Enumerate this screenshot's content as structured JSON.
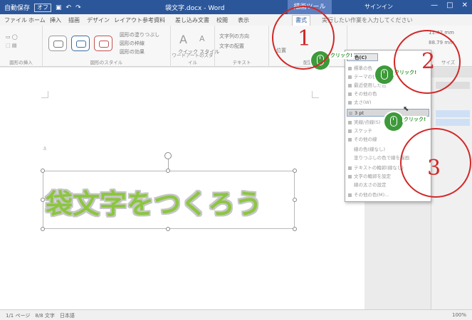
{
  "titlebar": {
    "autosave_label": "自動保存",
    "autosave_state": "オフ",
    "doc_title": "袋文字.docx - Word",
    "context_tab": "描画ツール",
    "user": "サインイン",
    "min_glyph": "—",
    "max_glyph": "□",
    "close_glyph": "✕"
  },
  "ribbon": {
    "tabs": [
      "ファイル",
      "ホーム",
      "挿入",
      "描画",
      "デザイン",
      "レイアウト",
      "参考資料",
      "差し込み文書",
      "校閲",
      "表示"
    ],
    "active_tab": "書式",
    "search_placeholder": "実行したい作業を入力してください",
    "groups": {
      "insert_shapes": "図形の挿入",
      "shape_styles": "図形のスタイル",
      "wordart_styles": "ワードアートのスタイル",
      "text": "テキスト",
      "arrange": "配置",
      "size": "サイズ"
    },
    "fill_label": "図形の塗りつぶし",
    "outline_label": "図形の枠線",
    "effects_label": "図形の効果",
    "quick_styles": "クイック スタイル",
    "text_direction": "文字列の方向",
    "text_align": "文字の配置",
    "position": "位置",
    "height": "11.42 mm",
    "width": "88.79 mm"
  },
  "menu": {
    "header": "色(C)",
    "items": [
      "標準の色",
      "テーマの色",
      "最近使用した色",
      "その他の色",
      "太さ(W)",
      "実線/点線(S)",
      "スケッチ",
      "その他の線",
      "線の色(線なし)",
      "塗りつぶしの色で線を描画",
      "テキストの輪郭(線なし)",
      "文字の輪郭を設定",
      "線の太さの設定",
      "その他の色(M)..."
    ],
    "highlighted": "3 pt"
  },
  "annotations": {
    "n1": "1",
    "n2": "2",
    "n3": "3",
    "click_label": "クリック!"
  },
  "document": {
    "wordart_text": "袋文字をつくろう",
    "accent": "#8cc63f",
    "outline": "#c6c6c6"
  },
  "status": {
    "left": "1/1 ページ　8/8 文字　日本語",
    "right": "100%"
  },
  "colors": {
    "titlebar": "#2b579a",
    "annotation": "#d12828",
    "badge": "#3d9a3a"
  }
}
